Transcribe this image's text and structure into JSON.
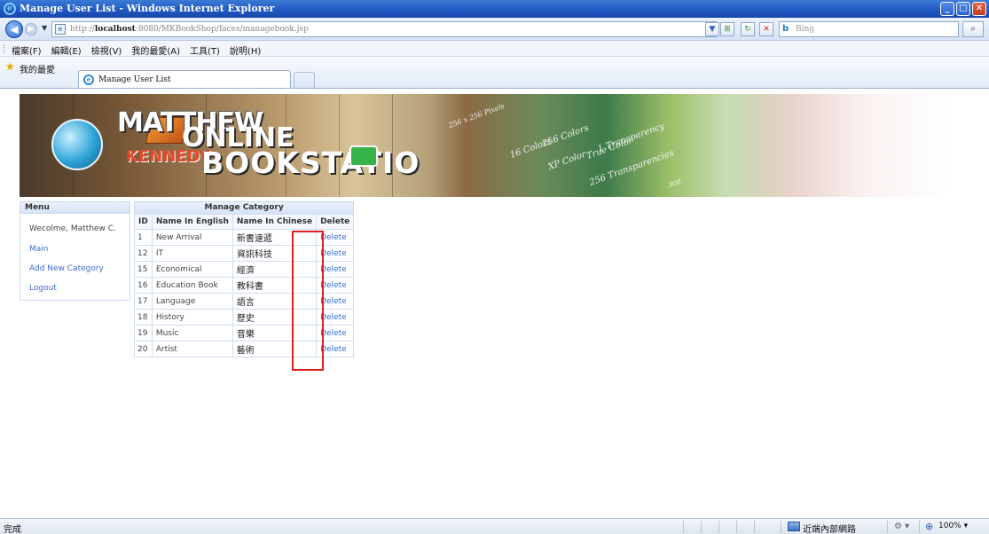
{
  "window": {
    "title": "Manage User List - Windows Internet Explorer",
    "controls": {
      "minimize": "_",
      "maximize": "▢",
      "close": "✕"
    }
  },
  "address_bar": {
    "url_prefix": "http://",
    "url_host": "localhost",
    "url_rest": ":8080/MKBookShop/faces/managebook.jsp",
    "search_placeholder": "Bing",
    "icons": [
      "back-icon",
      "forward-icon",
      "page-icon",
      "refresh-icon",
      "stop-icon",
      "bing-icon",
      "search-icon"
    ]
  },
  "menu_bar": {
    "items": [
      "檔案(F)",
      "編輯(E)",
      "檢視(V)",
      "我的最愛(A)",
      "工具(T)",
      "說明(H)"
    ]
  },
  "favorites_bar": {
    "favorites_label": "我的最愛",
    "tab_title": "Manage User List"
  },
  "banner": {
    "logo_top": "MATTHEW",
    "logo_online": "ONLINE",
    "logo_bottom": "KENNEDY",
    "logo_bookstation": "BOOKSTATIO",
    "decor": [
      "256 x 256 Pixels",
      "16 Colors",
      "256 Colors",
      "True Color",
      "XP Color",
      "1 Transparency",
      "256 Transparencies",
      ".ico"
    ]
  },
  "menu": {
    "title": "Menu",
    "welcome": "Wecolme, Matthew C.",
    "links": [
      "Main",
      "Add New Category",
      "Logout"
    ]
  },
  "category_table": {
    "title": "Manage Category",
    "headers": [
      "ID",
      "Name In English",
      "Name In Chinese",
      "Delete"
    ],
    "rows": [
      {
        "id": "1",
        "en": "New Arrival",
        "zh": "新書速遞",
        "del": "Delete"
      },
      {
        "id": "12",
        "en": "IT",
        "zh": "資訊科技",
        "del": "Delete"
      },
      {
        "id": "15",
        "en": "Economical",
        "zh": "經濟",
        "del": "Delete"
      },
      {
        "id": "16",
        "en": "Education Book",
        "zh": "教科書",
        "del": "Delete"
      },
      {
        "id": "17",
        "en": "Language",
        "zh": "語言",
        "del": "Delete"
      },
      {
        "id": "18",
        "en": "History",
        "zh": "歷史",
        "del": "Delete"
      },
      {
        "id": "19",
        "en": "Music",
        "zh": "音樂",
        "del": "Delete"
      },
      {
        "id": "20",
        "en": "Artist",
        "zh": "藝術",
        "del": "Delete"
      }
    ]
  },
  "status_bar": {
    "status": "完成",
    "zone": "近端內部網路",
    "zoom": "100%"
  },
  "colors": {
    "highlight_box": "#e02020",
    "link": "#3a6ad0",
    "titlebar": "#1f56c2"
  }
}
